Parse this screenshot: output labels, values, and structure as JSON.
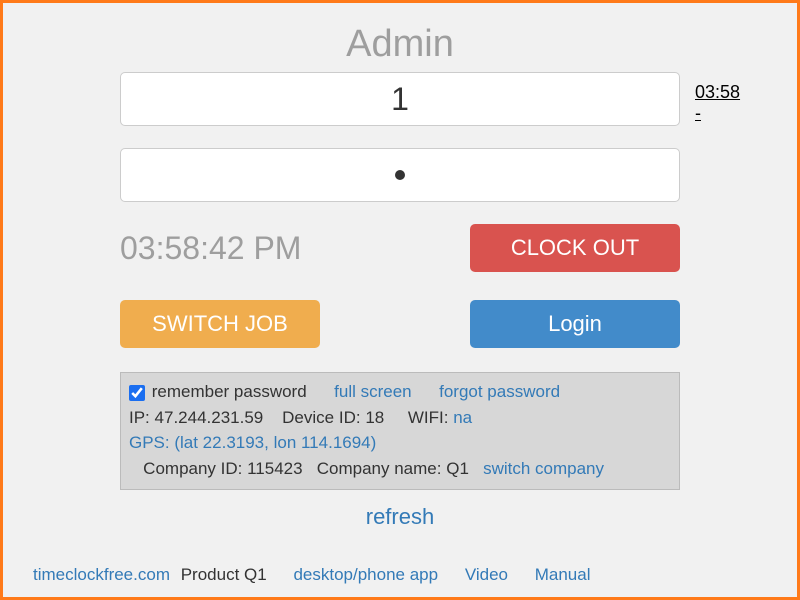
{
  "title": "Admin",
  "employee_id": "1",
  "side_time": "03:58 -",
  "password_masked": "•",
  "clock_time": "03:58:42 PM",
  "buttons": {
    "clock_out": "CLOCK OUT",
    "switch_job": "SWITCH JOB",
    "login": "Login"
  },
  "info": {
    "remember_label": "remember password",
    "remember_checked": true,
    "full_screen": "full screen",
    "forgot_password": "forgot password",
    "ip_label": "IP:",
    "ip": "47.244.231.59",
    "device_label": "Device ID:",
    "device": "18",
    "wifi_label": "WIFI:",
    "wifi": "na",
    "gps": "GPS: (lat 22.3193, lon 114.1694)",
    "company_id_label": "Company ID:",
    "company_id": "115423",
    "company_name_label": "Company name:",
    "company_name": "Q1",
    "switch_company": "switch company"
  },
  "refresh": "refresh",
  "footer": {
    "site": "timeclockfree.com",
    "product": "Product Q1",
    "app": "desktop/phone app",
    "video": "Video",
    "manual": "Manual"
  }
}
